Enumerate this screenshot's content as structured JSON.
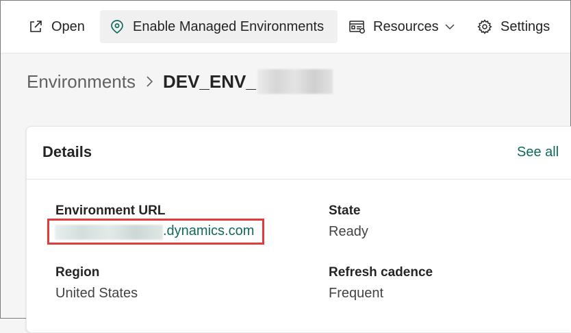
{
  "commandbar": {
    "open_label": "Open",
    "managed_label": "Enable Managed Environments",
    "resources_label": "Resources",
    "settings_label": "Settings"
  },
  "breadcrumb": {
    "parent": "Environments",
    "current": "DEV_ENV_"
  },
  "details": {
    "title": "Details",
    "see_all": "See all",
    "env_url_label": "Environment URL",
    "env_url_value": ".dynamics.com",
    "state_label": "State",
    "state_value": "Ready",
    "region_label": "Region",
    "region_value": "United States",
    "refresh_label": "Refresh cadence",
    "refresh_value": "Frequent"
  },
  "colors": {
    "accent": "#0f6a5c",
    "highlight_border": "#e03a3a"
  },
  "icons": {
    "open": "open-external-icon",
    "managed": "managed-environment-icon",
    "resources": "resources-icon",
    "settings": "gear-icon"
  }
}
